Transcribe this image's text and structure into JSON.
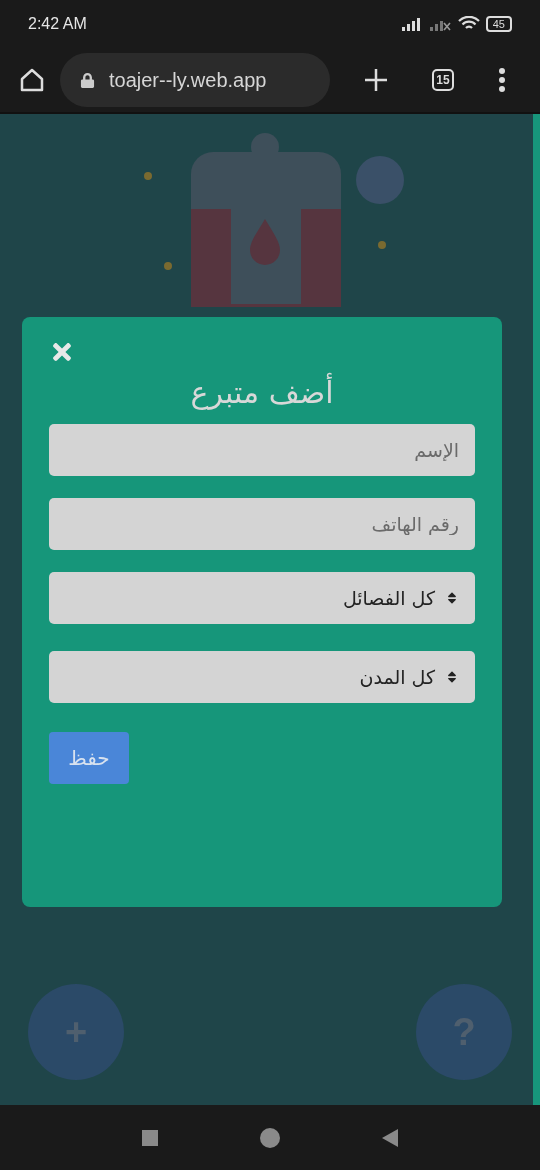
{
  "status_bar": {
    "time": "2:42 AM",
    "battery": "45"
  },
  "browser": {
    "url": "toajer--ly.web.app",
    "tab_count": "15"
  },
  "modal": {
    "title": "أضف متبرع",
    "fields": [
      {
        "kind": "input",
        "placeholder": "الإسم"
      },
      {
        "kind": "input",
        "placeholder": "رقم الهاتف"
      },
      {
        "kind": "select",
        "value": "كل الفصائل"
      },
      {
        "kind": "select",
        "value": "كل المدن"
      }
    ],
    "save_button": "حفظ"
  },
  "fabs": [
    {
      "label": "?"
    },
    {
      "label": "+"
    }
  ]
}
